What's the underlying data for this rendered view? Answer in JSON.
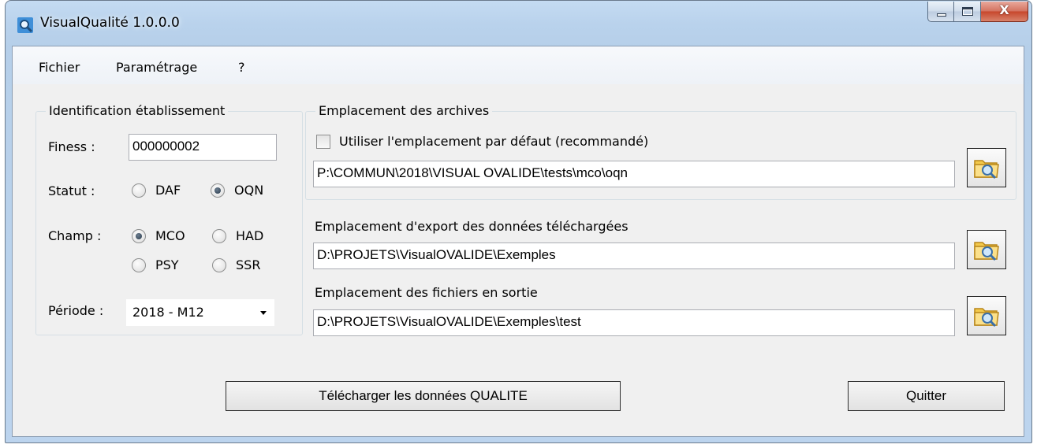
{
  "window": {
    "title": "VisualQualité 1.0.0.0",
    "controls": {
      "close_glyph": "X"
    }
  },
  "menu": [
    "Fichier",
    "Paramétrage",
    "?"
  ],
  "identification": {
    "title": "Identification établissement",
    "finess_label": "Finess :",
    "finess_value": "000000002",
    "statut_label": "Statut :",
    "statut_options": [
      {
        "label": "DAF",
        "checked": false
      },
      {
        "label": "OQN",
        "checked": true
      }
    ],
    "champ_label": "Champ :",
    "champ_options": [
      {
        "label": "MCO",
        "checked": true
      },
      {
        "label": "HAD",
        "checked": false
      },
      {
        "label": "PSY",
        "checked": false
      },
      {
        "label": "SSR",
        "checked": false
      }
    ],
    "periode_label": "Période :",
    "periode_value": "2018 - M12"
  },
  "archives": {
    "title": "Emplacement des archives",
    "default_checkbox_label": "Utiliser l'emplacement par défaut (recommandé)",
    "default_checked": false,
    "path": "P:\\COMMUN\\2018\\VISUAL OVALIDE\\tests\\mco\\oqn"
  },
  "export": {
    "label": "Emplacement d'export des données téléchargées",
    "path": "D:\\PROJETS\\VisualOVALIDE\\Exemples"
  },
  "output": {
    "label": "Emplacement des fichiers en sortie",
    "path": "D:\\PROJETS\\VisualOVALIDE\\Exemples\\test"
  },
  "buttons": {
    "download": "Télécharger les données QUALITE",
    "quit": "Quitter"
  },
  "icons": {
    "app": "magnifier-icon",
    "browse": "folder-search-icon"
  }
}
